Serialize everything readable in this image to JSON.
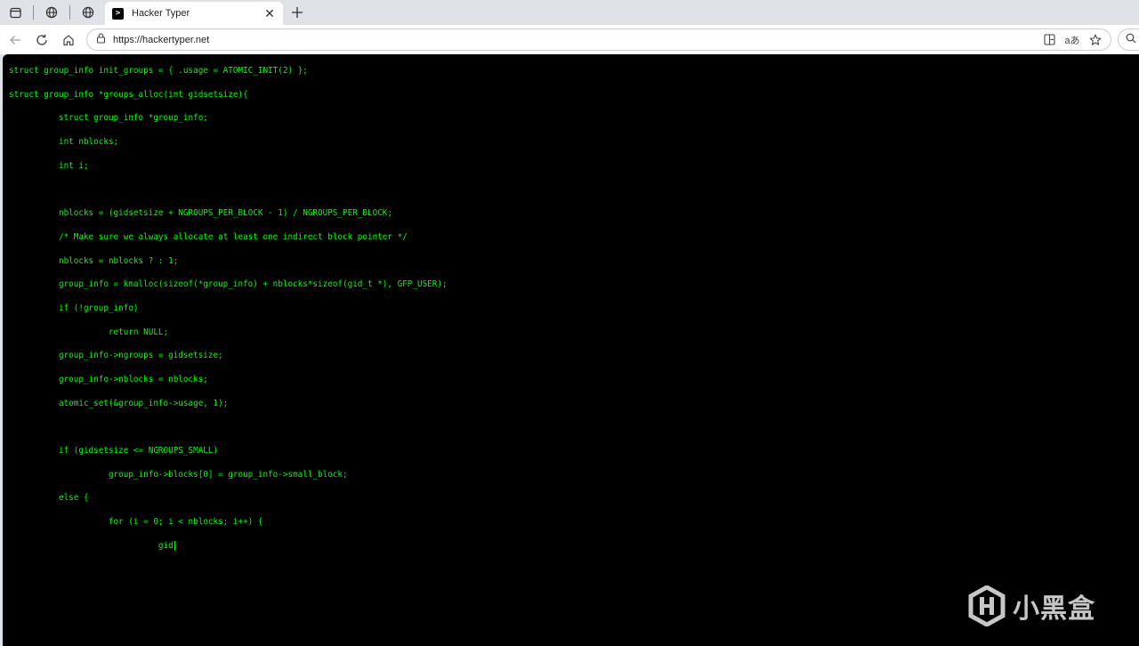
{
  "browser": {
    "tabs": [
      {
        "title": "Hacker Typer",
        "favicon_glyph": ">",
        "active": true
      }
    ],
    "address": {
      "url": "https://hackertyper.net"
    },
    "icons": {
      "tab_actions": "tab-actions-icon",
      "workspaces": "globe-icon",
      "back": "back-arrow-icon",
      "refresh": "refresh-icon",
      "home": "home-icon",
      "site_info": "lock-icon",
      "split_screen": "split-screen-icon",
      "read_aloud": "read-aloud-icon",
      "favorite": "star-icon",
      "search": "search-icon"
    },
    "read_aloud_label": "aあ"
  },
  "terminal": {
    "text_color": "#00ff00",
    "background": "#000000",
    "lines": [
      "struct group_info init_groups = { .usage = ATOMIC_INIT(2) };",
      "struct group_info *groups_alloc(int gidsetsize){",
      "\tstruct group_info *group_info;",
      "\tint nblocks;",
      "\tint i;",
      "",
      "\tnblocks = (gidsetsize + NGROUPS_PER_BLOCK - 1) / NGROUPS_PER_BLOCK;",
      "\t/* Make sure we always allocate at least one indirect block pointer */",
      "\tnblocks = nblocks ? : 1;",
      "\tgroup_info = kmalloc(sizeof(*group_info) + nblocks*sizeof(gid_t *), GFP_USER);",
      "\tif (!group_info)",
      "\t\treturn NULL;",
      "\tgroup_info->ngroups = gidsetsize;",
      "\tgroup_info->nblocks = nblocks;",
      "\tatomic_set(&group_info->usage, 1);",
      "",
      "\tif (gidsetsize <= NGROUPS_SMALL)",
      "\t\tgroup_info->blocks[0] = group_info->small_block;",
      "\telse {",
      "\t\tfor (i = 0; i < nblocks; i++) {",
      "\t\t\tgid"
    ]
  },
  "watermark": {
    "text": "小黑盒"
  }
}
